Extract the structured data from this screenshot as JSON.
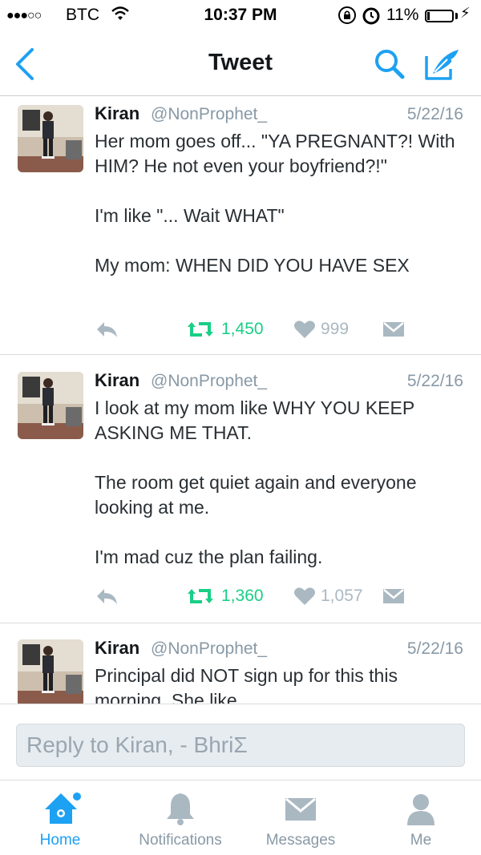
{
  "status_bar": {
    "carrier": "BTC",
    "time": "10:37 PM",
    "battery_pct": "11%",
    "battery_level": 0.11
  },
  "nav": {
    "title": "Tweet",
    "back_icon": "chevron-left-icon",
    "search_icon": "search-icon",
    "compose_icon": "compose-icon",
    "accent_color": "#1da1f2"
  },
  "tweets": [
    {
      "name": "Kiran",
      "handle": "@NonProphet_",
      "date": "5/22/16",
      "text": "Her mom goes off... \"YA PREGNANT?! With HIM? He not even your boyfriend?!\"\n\nI'm like \"... Wait WHAT\"\n\nMy mom: WHEN DID YOU HAVE SEX",
      "retweets": "1,450",
      "likes": "999"
    },
    {
      "name": "Kiran",
      "handle": "@NonProphet_",
      "date": "5/22/16",
      "text": "I look at my mom like WHY YOU KEEP ASKING ME THAT.\n\nThe room get quiet again and everyone looking at me.\n\nI'm mad cuz the plan failing.",
      "retweets": "1,360",
      "likes": "1,057"
    },
    {
      "name": "Kiran",
      "handle": "@NonProphet_",
      "date": "5/22/16",
      "text": "Principal did NOT sign up for this this morning. She like"
    }
  ],
  "reply": {
    "placeholder": "Reply to Kiran, - BhriΣ"
  },
  "tabs": [
    {
      "label": "Home",
      "icon": "home-icon",
      "active": true
    },
    {
      "label": "Notifications",
      "icon": "bell-icon",
      "active": false
    },
    {
      "label": "Messages",
      "icon": "envelope-icon",
      "active": false
    },
    {
      "label": "Me",
      "icon": "person-icon",
      "active": false
    }
  ]
}
